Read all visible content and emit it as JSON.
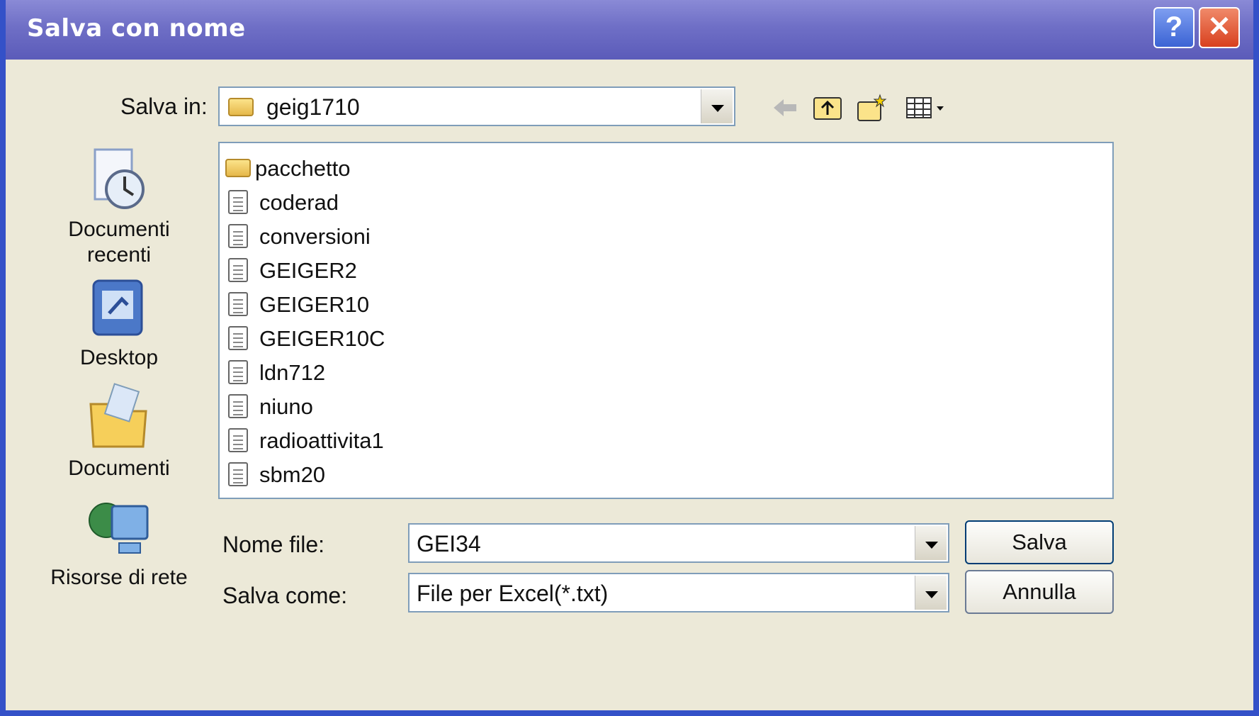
{
  "window": {
    "title": "Salva con nome",
    "help_glyph": "?",
    "close_glyph": "✕"
  },
  "save_in": {
    "label": "Salva in:",
    "value": "geig1710"
  },
  "places": [
    {
      "label": "Documenti recenti",
      "icon": "recent-documents-icon"
    },
    {
      "label": "Desktop",
      "icon": "desktop-icon"
    },
    {
      "label": "Documenti",
      "icon": "my-documents-icon"
    },
    {
      "label": "Risorse di rete",
      "icon": "network-places-icon"
    }
  ],
  "files": [
    {
      "name": "pacchetto",
      "type": "folder"
    },
    {
      "name": "coderad",
      "type": "file"
    },
    {
      "name": "conversioni",
      "type": "file"
    },
    {
      "name": "GEIGER2",
      "type": "file"
    },
    {
      "name": "GEIGER10",
      "type": "file"
    },
    {
      "name": "GEIGER10C",
      "type": "file"
    },
    {
      "name": "ldn712",
      "type": "file"
    },
    {
      "name": "niuno",
      "type": "file"
    },
    {
      "name": "radioattivita1",
      "type": "file"
    },
    {
      "name": "sbm20",
      "type": "file"
    }
  ],
  "filename": {
    "label": "Nome file:",
    "value": "GEI34"
  },
  "save_as": {
    "label": "Salva come:",
    "value": "File per Excel(*.txt)"
  },
  "buttons": {
    "save": "Salva",
    "cancel": "Annulla"
  },
  "toolbar": {
    "icons": [
      "back-arrow-icon",
      "up-folder-icon",
      "new-folder-icon",
      "view-menu-icon"
    ]
  }
}
